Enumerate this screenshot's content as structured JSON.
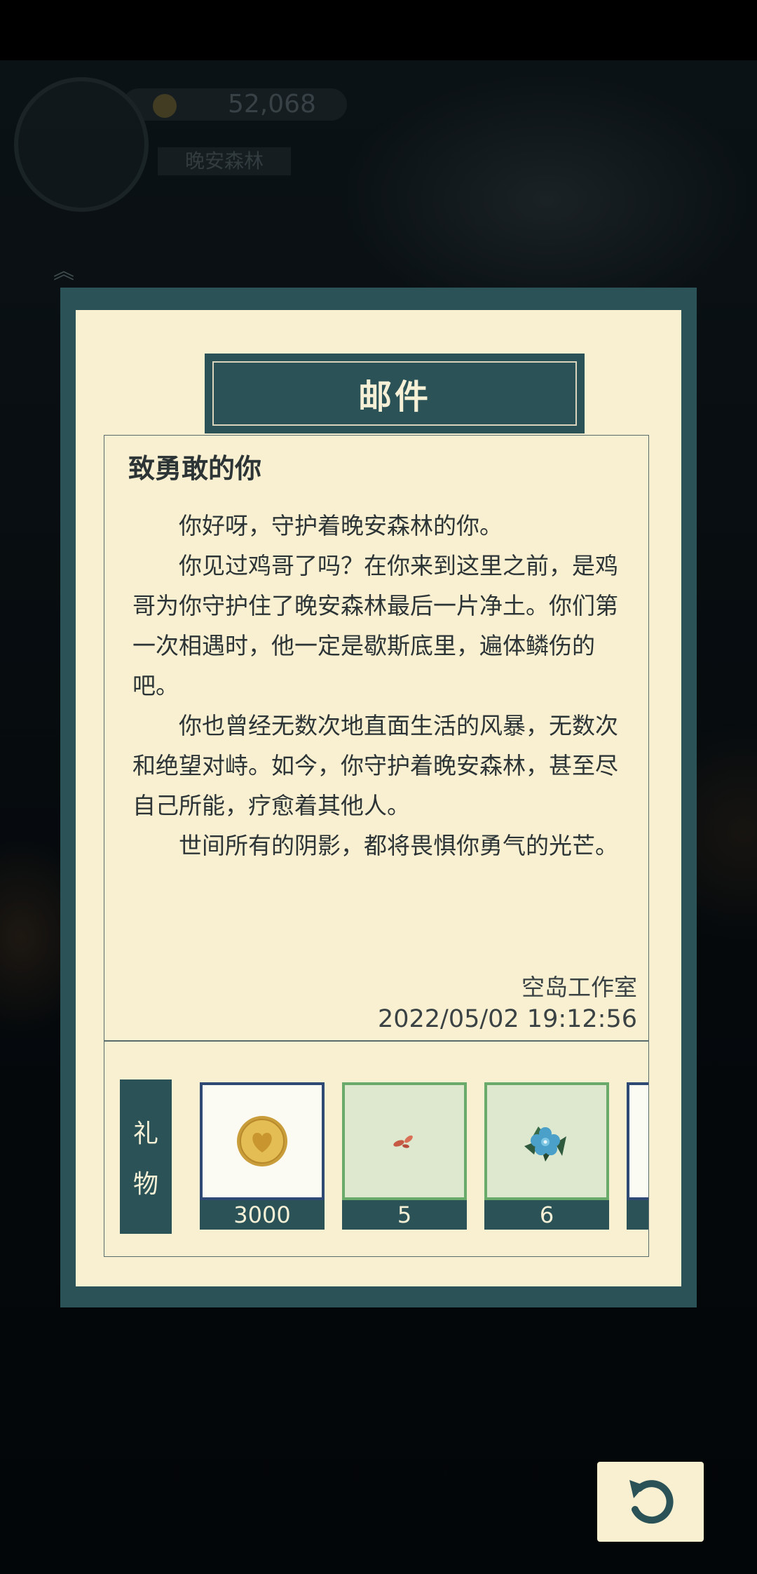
{
  "background_hud": {
    "coins": "52,068",
    "tag": "晚安森林"
  },
  "dialog": {
    "title": "邮件",
    "letter": {
      "heading": "致勇敢的你",
      "paragraphs": [
        "你好呀，守护着晚安森林的你。",
        "你见过鸡哥了吗？在你来到这里之前，是鸡哥为你守护住了晚安森林最后一片净土。你们第一次相遇时，他一定是歇斯底里，遍体鳞伤的吧。",
        "你也曾经无数次地直面生活的风暴，无数次和绝望对峙。如今，你守护着晚安森林，甚至尽自己所能，疗愈着其他人。",
        "世间所有的阴影，都将畏惧你勇气的光芒。"
      ],
      "sender": "空岛工作室",
      "datetime": "2022/05/02  19:12:56"
    },
    "gifts": {
      "label_top": "礼",
      "label_bottom": "物",
      "items": [
        {
          "icon": "heart-coin-icon",
          "count": "3000"
        },
        {
          "icon": "seeds-icon",
          "count": "5"
        },
        {
          "icon": "blue-flower-icon",
          "count": "6"
        }
      ]
    }
  },
  "colors": {
    "panel": "#2b5257",
    "paper": "#f9f0d2",
    "gift_border_rare": "#2e4a74",
    "gift_border_common": "#6aaa6a"
  }
}
